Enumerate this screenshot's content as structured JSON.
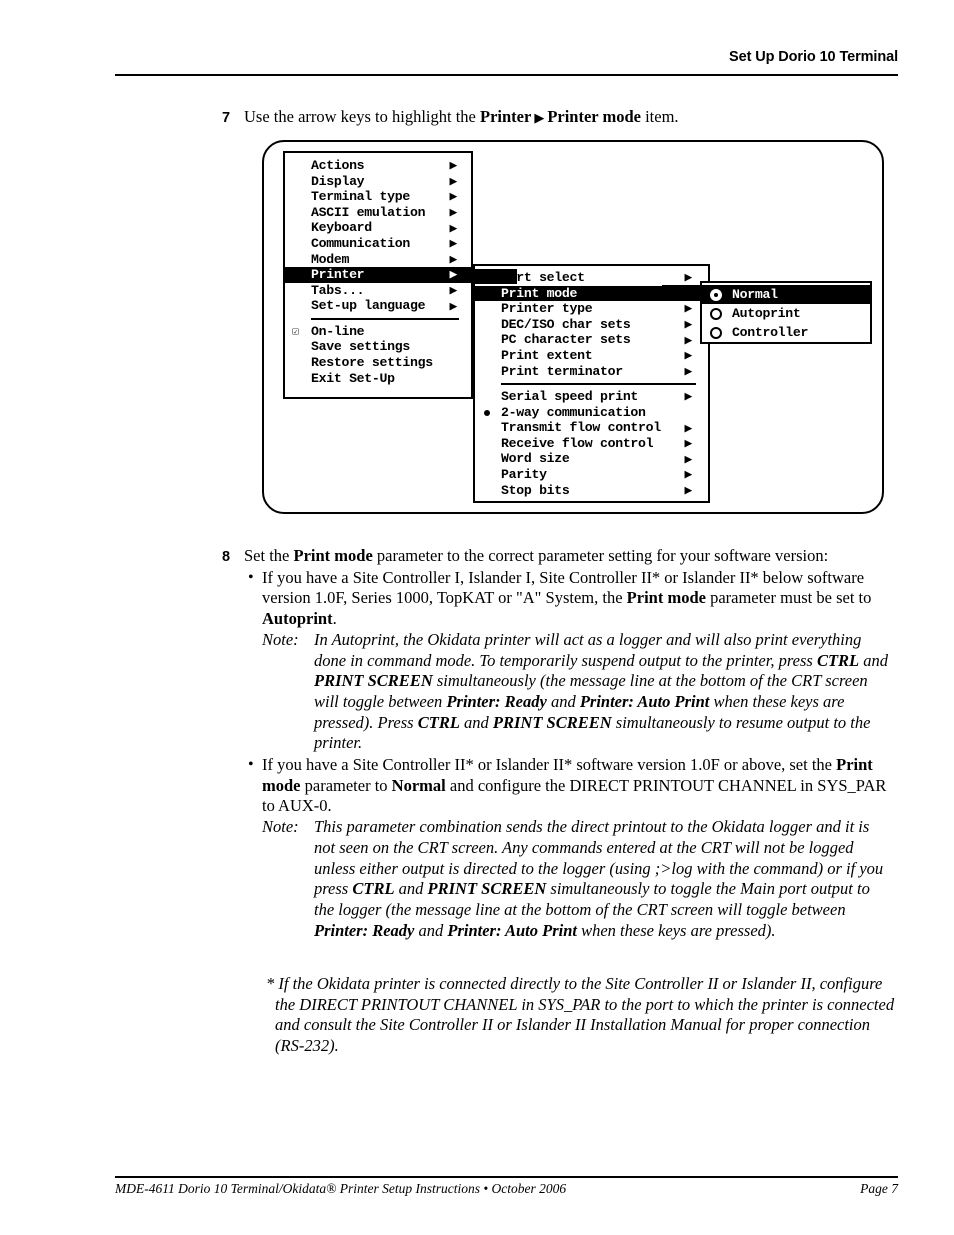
{
  "header": {
    "title": "Set Up Dorio 10 Terminal"
  },
  "footer": {
    "left": "MDE-4611 Dorio 10 Terminal/Okidata® Printer Setup Instructions • October 2006",
    "right": "Page 7"
  },
  "steps": {
    "step7": {
      "number": "7",
      "text_before": "Use the arrow keys to highlight the ",
      "bold1": "Printer",
      "arrow_glyph": "▶",
      "bold2": "Printer mode",
      "text_after": " item."
    },
    "step8": {
      "number": "8",
      "lead_before": "Set the ",
      "lead_bold": "Print mode",
      "lead_after": " parameter to the correct parameter setting for your software version:",
      "bullet_glyph": "•",
      "bullet1": {
        "seg1": "If you have a Site Controller I, Islander I, Site Controller II* or Islander II* below software version 1.0F, Series 1000, TopKAT or \"A\" System, the ",
        "bold1": "Print mode",
        "seg2": " parameter must be set to ",
        "bold2": "Autoprint",
        "seg3": "."
      },
      "note1": {
        "label": "Note:",
        "seg1": "In Autoprint, the Okidata printer will act as a logger and will also print everything done in command mode. To temporarily suspend output to the printer, press ",
        "bold1": "CTRL",
        "seg2": " and ",
        "bold2": "PRINT SCREEN",
        "seg3": " simultaneously (the message line at the bottom of the CRT screen will toggle between ",
        "bold3": "Printer: Ready",
        "seg4": " and ",
        "bold4": "Printer: Auto Print",
        "seg5": " when these keys are pressed).  Press ",
        "bold5": "CTRL",
        "seg6": " and ",
        "bold6": "PRINT SCREEN",
        "seg7": " simultaneously to resume output to the printer."
      },
      "bullet2": {
        "seg1": "If you have a Site Controller II* or Islander II* software version 1.0F or above, set the ",
        "bold1": "Print mode",
        "seg2": " parameter to ",
        "bold2": "Normal",
        "seg3": " and configure the DIRECT PRINTOUT CHANNEL in SYS_PAR to AUX-0."
      },
      "note2": {
        "label": "Note:",
        "seg1": "This parameter combination sends the direct printout to the Okidata logger and it is not seen on the CRT screen. Any commands entered at the CRT will not be logged unless either output is directed to the logger (using ;>log with the command) or if you press ",
        "bold1": "CTRL",
        "seg2": " and ",
        "bold2": "PRINT SCREEN",
        "seg3": " simultaneously to toggle the Main port output to the logger (the message line at the bottom of the CRT screen will toggle between ",
        "bold3": "Printer: Ready",
        "seg4": " and ",
        "bold4": "Printer: Auto Print",
        "seg5": " when these keys are pressed)."
      }
    }
  },
  "footnote": {
    "text": "* If the Okidata printer is connected directly to the Site Controller II or Islander II, configure the DIRECT PRINTOUT CHANNEL in SYS_PAR to the port to which the printer is connected and consult the Site Controller II or Islander II Installation Manual for proper connection (RS-232)."
  },
  "diagram": {
    "arrow_glyph": "▶",
    "check_glyph": "☑",
    "main_menu": {
      "items": [
        {
          "label": "Actions",
          "arrow": true,
          "selected": false
        },
        {
          "label": "Display",
          "arrow": true,
          "selected": false
        },
        {
          "label": "Terminal type",
          "arrow": true,
          "selected": false
        },
        {
          "label": "ASCII emulation",
          "arrow": true,
          "selected": false
        },
        {
          "label": "Keyboard",
          "arrow": true,
          "selected": false
        },
        {
          "label": "Communication",
          "arrow": true,
          "selected": false
        },
        {
          "label": "Modem",
          "arrow": true,
          "selected": false
        },
        {
          "label": "Printer",
          "arrow": true,
          "selected": true
        },
        {
          "label": "Tabs...",
          "arrow": true,
          "selected": false
        },
        {
          "label": "Set-up language",
          "arrow": true,
          "selected": false
        }
      ],
      "items2": [
        {
          "label": "On-line",
          "arrow": false,
          "selected": false,
          "checked": true
        },
        {
          "label": "Save settings",
          "arrow": false,
          "selected": false
        },
        {
          "label": "Restore settings",
          "arrow": false,
          "selected": false
        },
        {
          "label": "Exit Set-Up",
          "arrow": false,
          "selected": false
        }
      ]
    },
    "printer_menu": {
      "items": [
        {
          "label": "Port select",
          "arrow": true,
          "selected": false
        },
        {
          "label": "Print mode",
          "arrow": true,
          "selected": true
        },
        {
          "label": "Printer type",
          "arrow": true,
          "selected": false
        },
        {
          "label": "DEC/ISO char sets",
          "arrow": true,
          "selected": false
        },
        {
          "label": "PC character sets",
          "arrow": true,
          "selected": false
        },
        {
          "label": "Print extent",
          "arrow": true,
          "selected": false
        },
        {
          "label": "Print terminator",
          "arrow": true,
          "selected": false
        }
      ],
      "items2": [
        {
          "label": "Serial speed print",
          "arrow": true,
          "selected": false
        },
        {
          "label": "2-way communication",
          "arrow": false,
          "selected": false,
          "dot": true
        },
        {
          "label": "Transmit flow control",
          "arrow": true,
          "selected": false
        },
        {
          "label": "Receive flow control",
          "arrow": true,
          "selected": false
        },
        {
          "label": "Word size",
          "arrow": true,
          "selected": false
        },
        {
          "label": "Parity",
          "arrow": true,
          "selected": false
        },
        {
          "label": "Stop bits",
          "arrow": true,
          "selected": false
        }
      ]
    },
    "print_mode_menu": {
      "items": [
        {
          "label": "Normal",
          "radio": true,
          "selected": true
        },
        {
          "label": "Autoprint",
          "radio": false,
          "selected": false
        },
        {
          "label": "Controller",
          "radio": false,
          "selected": false
        }
      ]
    }
  }
}
